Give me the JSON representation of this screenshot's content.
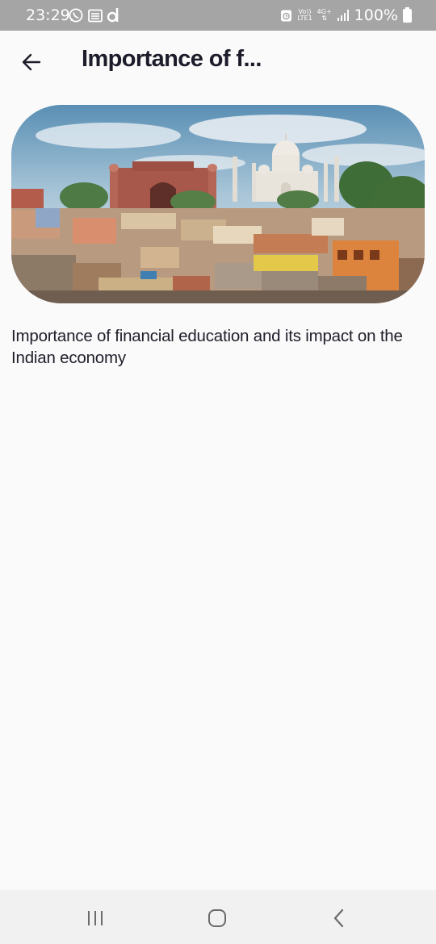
{
  "status_bar": {
    "time": "23:29",
    "network_top": "Vo))",
    "network_bottom": "LTE1",
    "signal_type": "4G+",
    "battery": "100%",
    "icons": [
      "whatsapp-icon",
      "sim-card-icon",
      "d-app-icon",
      "alarm-icon",
      "signal-icon",
      "battery-icon"
    ]
  },
  "header": {
    "title": "Importance of f...",
    "back_icon": "arrow-left-icon"
  },
  "article": {
    "hero_image": "taj-mahal-city-photo",
    "description": "Importance of financial education and its impact on the Indian economy"
  },
  "nav_bar": {
    "icons": [
      "recent-apps-icon",
      "home-icon",
      "back-icon"
    ]
  },
  "colors": {
    "status_bar": "#a5a5a5",
    "background": "#fafafa",
    "text": "#1d1d29",
    "nav_bar": "#f1f1f1"
  }
}
